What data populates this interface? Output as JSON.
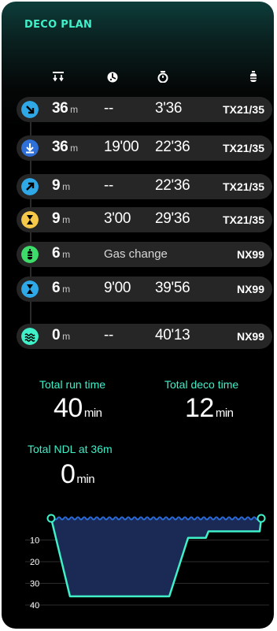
{
  "title": "DECO PLAN",
  "columns": {
    "depth_icon": "descent-arrows-icon",
    "stop_icon": "stopwatch-icon",
    "runtime_icon": "diver-timer-icon",
    "gas_icon": "gas-cylinder-icon"
  },
  "plan": [
    {
      "icon": "descent-icon",
      "icon_color": "#2fa8e8",
      "depth": "36",
      "unit": "m",
      "stop": "--",
      "runtime": "3'36",
      "gas": "TX21/35"
    },
    {
      "icon": "bottom-icon",
      "icon_color": "#2f6fd8",
      "depth": "36",
      "unit": "m",
      "stop": "19'00",
      "runtime": "22'36",
      "gas": "TX21/35"
    },
    {
      "icon": "ascent-icon",
      "icon_color": "#2fa8e8",
      "depth": "9",
      "unit": "m",
      "stop": "--",
      "runtime": "22'36",
      "gas": "TX21/35"
    },
    {
      "icon": "deco-stop-hourglass-icon",
      "icon_color": "#f5c84a",
      "depth": "9",
      "unit": "m",
      "stop": "3'00",
      "runtime": "29'36",
      "gas": "TX21/35"
    },
    {
      "icon": "gas-change-icon",
      "icon_color": "#3ddc6a",
      "depth": "6",
      "unit": "m",
      "event": "Gas change",
      "gas": "NX99"
    },
    {
      "icon": "safety-stop-hourglass-icon",
      "icon_color": "#2fa8e8",
      "depth": "6",
      "unit": "m",
      "stop": "9'00",
      "runtime": "39'56",
      "gas": "NX99"
    },
    {
      "icon": "surface-waves-icon",
      "icon_color": "#3ff0c9",
      "depth": "0",
      "unit": "m",
      "stop": "--",
      "runtime": "40'13",
      "gas": "NX99"
    }
  ],
  "stats": {
    "total_run_label": "Total run time",
    "total_run_value": "40",
    "total_deco_label": "Total deco time",
    "total_deco_value": "12",
    "ndl_label": "Total NDL at 36m",
    "ndl_value": "0",
    "unit": "min"
  },
  "profile": {
    "ticks": [
      "10",
      "20",
      "30",
      "40"
    ],
    "points": [
      [
        0,
        0
      ],
      [
        3.6,
        36
      ],
      [
        22.6,
        36
      ],
      [
        26.2,
        9
      ],
      [
        29.6,
        9
      ],
      [
        30.1,
        6
      ],
      [
        39.9,
        6
      ],
      [
        40.2,
        0
      ]
    ],
    "max_depth": 40,
    "max_time": 40.2,
    "line_color": "#3ff0c9",
    "fill_color": "#1a2a55",
    "surface_color": "#2a6ad8"
  }
}
